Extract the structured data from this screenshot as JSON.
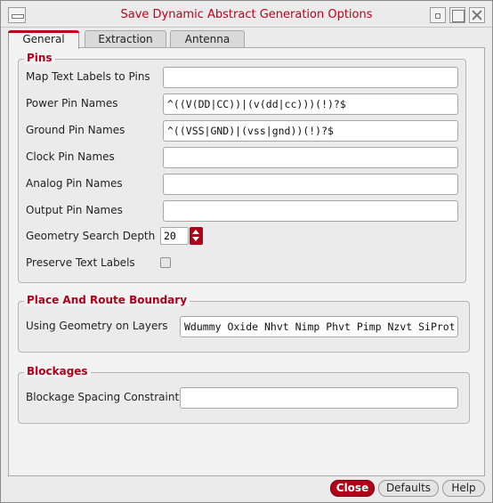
{
  "window": {
    "title": "Save Dynamic Abstract Generation Options"
  },
  "tabs": [
    {
      "label": "General",
      "active": true
    },
    {
      "label": "Extraction",
      "active": false
    },
    {
      "label": "Antenna",
      "active": false
    }
  ],
  "pins": {
    "title": "Pins",
    "map_text_labels": {
      "label": "Map Text Labels to Pins",
      "value": ""
    },
    "power_pin_names": {
      "label": "Power Pin Names",
      "value": "^((V(DD|CC))|(v(dd|cc)))(!)?$"
    },
    "ground_pin_names": {
      "label": "Ground Pin Names",
      "value": "^((VSS|GND)|(vss|gnd))(!)?$"
    },
    "clock_pin_names": {
      "label": "Clock Pin Names",
      "value": ""
    },
    "analog_pin_names": {
      "label": "Analog Pin Names",
      "value": ""
    },
    "output_pin_names": {
      "label": "Output Pin Names",
      "value": ""
    },
    "geometry_search_depth": {
      "label": "Geometry Search Depth",
      "value": "20"
    },
    "preserve_text_labels": {
      "label": "Preserve Text Labels",
      "checked": false
    }
  },
  "place_and_route": {
    "title": "Place And Route Boundary",
    "using_geometry": {
      "label": "Using Geometry on Layers",
      "value": "Wdummy Oxide Nhvt Nimp Phvt Pimp Nzvt SiProt"
    }
  },
  "blockages": {
    "title": "Blockages",
    "spacing_constraint": {
      "label": "Blockage Spacing Constraint",
      "value": ""
    }
  },
  "buttons": {
    "close": "Close",
    "defaults": "Defaults",
    "help": "Help"
  },
  "colors": {
    "accent": "#b0001a",
    "title_text": "#c0001a",
    "background": "#ebebeb"
  }
}
